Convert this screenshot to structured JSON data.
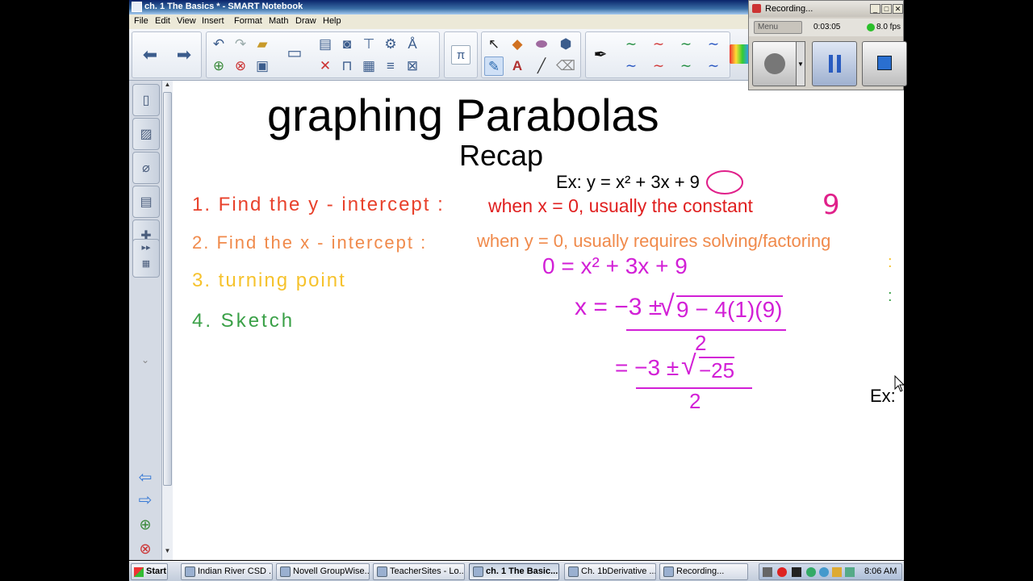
{
  "window": {
    "title": "ch. 1 The Basics * - SMART Notebook"
  },
  "menu": [
    "File",
    "Edit",
    "View",
    "Insert",
    "Format",
    "Math",
    "Draw",
    "Help"
  ],
  "page": {
    "title": "graphing Parabolas",
    "subtitle": "Recap",
    "example": "Ex: y = x² + 3x + 9",
    "steps": [
      {
        "text": "1. Find the y - intercept :",
        "color": "#e8412b"
      },
      {
        "text": "2. Find the x - intercept :",
        "color": "#f08a4b"
      },
      {
        "text": "3. turning point",
        "color": "#f6c22c"
      },
      {
        "text": "4. Sketch",
        "color": "#3aa047"
      }
    ],
    "notes": [
      {
        "text": "when x = 0, usually the constant",
        "color": "#e02020"
      },
      {
        "text": "when y = 0, usually requires solving/factoring",
        "color": "#f08a4b"
      }
    ],
    "answer_9": "9",
    "work": {
      "line1": "0 = x² + 3x + 9",
      "line2_left": "x = −3 ±",
      "line2_radicand": "9 − 4(1)(9)",
      "denom": "2",
      "line3_left": "= −3 ±",
      "line3_radicand": "−25",
      "denom2": "2",
      "color": "#d21fd6"
    },
    "ex_right": "Ex:"
  },
  "recorder": {
    "title": "Recording...",
    "menu_label": "Menu",
    "time": "0:03:05",
    "fps": "8.0 fps"
  },
  "taskbar": {
    "start": "Start",
    "tasks": [
      "Indian River CSD ...",
      "Novell GroupWise...",
      "TeacherSites - Lo...",
      "ch. 1 The Basic...",
      "Ch. 1bDerivative ...",
      "Recording..."
    ],
    "clock": "8:06 AM"
  }
}
